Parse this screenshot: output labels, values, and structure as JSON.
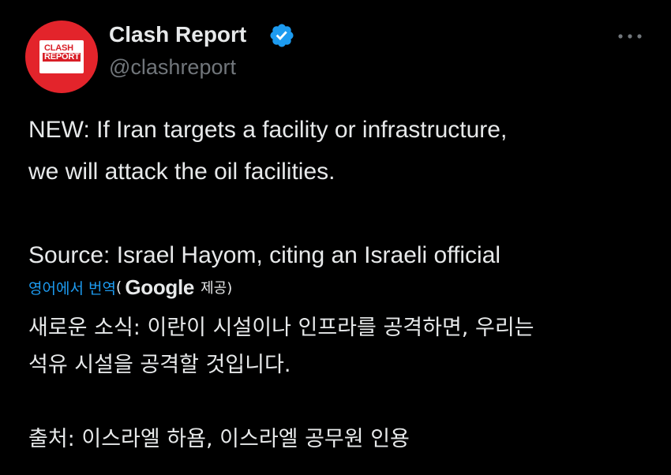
{
  "author": {
    "display_name": "Clash Report",
    "handle": "@clashreport",
    "verified": true,
    "avatar_text_line1": "CLASH",
    "avatar_text_line2": "REPORT",
    "avatar_color": "#e3242b"
  },
  "tweet": {
    "text": "NEW: If Iran targets a facility or infrastructure,\nwe will attack the oil facilities.\n\nSource: Israel Hayom, citing an Israeli official"
  },
  "translation": {
    "link_label": "영어에서 번역",
    "open_paren": "(",
    "provider": "Google",
    "provided_label": "제공)",
    "text": "새로운 소식: 이란이 시설이나 인프라를 공격하면, 우리는\n석유 시설을 공격할 것입니다.\n\n출처: 이스라엘 하욤, 이스라엘 공무원 인용"
  },
  "icons": {
    "verified": "verified-badge-icon",
    "more": "more-options-icon"
  },
  "colors": {
    "background": "#000000",
    "text": "#e7e9ea",
    "secondary": "#71767b",
    "accent": "#1d9bf0"
  }
}
